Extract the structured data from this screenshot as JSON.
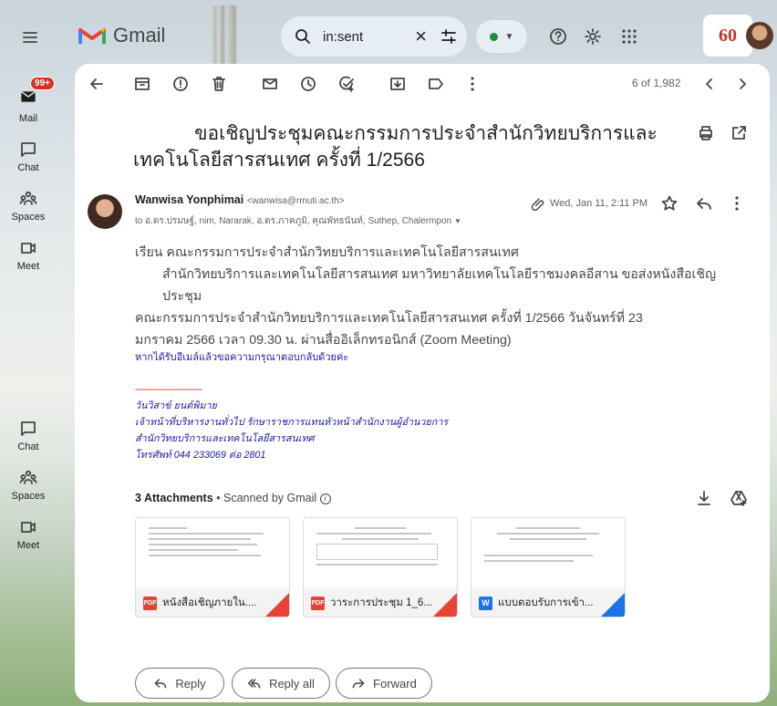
{
  "header": {
    "app_name": "Gmail",
    "search_query": "in:sent",
    "brand_mark": "60"
  },
  "rail": {
    "mail_label": "Mail",
    "mail_badge": "99+",
    "chat_label": "Chat",
    "spaces_label": "Spaces",
    "meet_label": "Meet"
  },
  "toolbar": {
    "count": "6 of 1,982"
  },
  "message": {
    "subject_line1": "ขอเชิญประชุมคณะกรรมการประจำสำนักวิทยบริการและ",
    "subject_line2": "เทคโนโลยีสารสนเทศ ครั้งที่ 1/2566",
    "sender_name": "Wanwisa Yonphimai",
    "sender_email": "<wanwisa@rmuti.ac.th>",
    "to": "to อ.ดร.ปรมษฐ์, nim, Nararak, อ.ดร.ภาคภูมิ, คุณพัทธนันท์, Suthep, Chalermpon",
    "date": "Wed, Jan 11, 2:11 PM",
    "body_line1": "เรียน คณะกรรมการประจำสำนักวิทยบริการและเทคโนโลยีสารสนเทศ",
    "body_line2": "สำนักวิทยบริการและเทคโนโลยีสารสนเทศ มหาวิทยาลัยเทคโนโลยีราชมงคลอีสาน ขอส่งหนังสือเชิญประชุม",
    "body_line3": "คณะกรรมการประจำสำนักวิทยบริการและเทคโนโลยีสารสนเทศ ครั้งที่ 1/2566 วันจันทร์ที่ 23",
    "body_line4": "มกราคม 2566 เวลา 09.30 น. ผ่านสื่ออิเล็กทรอนิกส์ (Zoom Meeting)",
    "request_note": "หากได้รับอีเมล์แล้วขอความกรุณาตอบกลับด้วยค่ะ",
    "sig_dashes": "----------------------------",
    "sig_name": "วันวิสาข์ ยนต์พิมาย",
    "sig_title": "เจ้าหน้าที่บริหารงานทั่วไป รักษาราชการแทนหัวหน้าสำนักงานผู้อำนวยการ",
    "sig_org": "สำนักวิทยบริการและเทคโนโลยีสารสนเทศ",
    "sig_phone": "โทรศัพท์ 044 233069 ต่อ 2801"
  },
  "attachments": {
    "count_label": "3 Attachments",
    "scanned": "Scanned by Gmail",
    "items": [
      {
        "name": "หนังสือเชิญภายใน....",
        "type": "PDF",
        "color": "#ea4335"
      },
      {
        "name": "วาระการประชุม 1_6...",
        "type": "PDF",
        "color": "#ea4335"
      },
      {
        "name": "แบบตอบรับการเข้า...",
        "type": "W",
        "color": "#1a73e8"
      }
    ]
  },
  "actions": {
    "reply": "Reply",
    "reply_all": "Reply all",
    "forward": "Forward"
  }
}
